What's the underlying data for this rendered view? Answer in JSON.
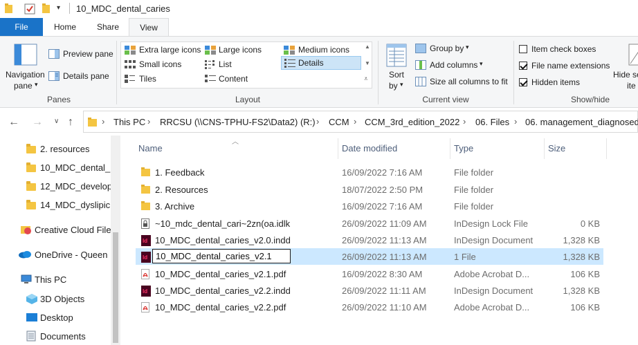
{
  "window": {
    "title": "10_MDC_dental_caries"
  },
  "tabs": [
    {
      "label": "File"
    },
    {
      "label": "Home"
    },
    {
      "label": "Share"
    },
    {
      "label": "View"
    }
  ],
  "ribbon": {
    "panes": {
      "navigation_pane_line1": "Navigation",
      "navigation_pane_line2": "pane",
      "preview_pane": "Preview pane",
      "details_pane": "Details pane",
      "label": "Panes"
    },
    "layout": {
      "extra_large_icons": "Extra large icons",
      "large_icons": "Large icons",
      "medium_icons": "Medium icons",
      "small_icons": "Small icons",
      "list": "List",
      "details": "Details",
      "tiles": "Tiles",
      "content": "Content",
      "label": "Layout"
    },
    "current_view": {
      "sort_by_line1": "Sort",
      "sort_by_line2": "by",
      "group_by": "Group by",
      "add_columns": "Add columns",
      "size_all_columns": "Size all columns to fit",
      "label": "Current view"
    },
    "show_hide": {
      "item_check_boxes": "Item check boxes",
      "file_name_extensions": "File name extensions",
      "hidden_items": "Hidden items",
      "hide_selected_line1": "Hide se",
      "hide_selected_line2": "ite",
      "label": "Show/hide",
      "item_check_boxes_checked": false,
      "file_name_extensions_checked": true,
      "hidden_items_checked": true
    }
  },
  "address": {
    "crumbs": [
      "This PC",
      "RRCSU (\\\\CNS-TPHU-FS2\\Data2) (R:)",
      "CCM",
      "CCM_3rd_edition_2022",
      "06. Files",
      "06. management_diagnosed"
    ]
  },
  "nav_pane": {
    "items": [
      {
        "label": "2. resources"
      },
      {
        "label": "10_MDC_dental_"
      },
      {
        "label": "12_MDC_develop"
      },
      {
        "label": "14_MDC_dyslipic"
      },
      {
        "label": "Creative Cloud File"
      },
      {
        "label": "OneDrive - Queen"
      },
      {
        "label": "This PC"
      },
      {
        "label": "3D Objects"
      },
      {
        "label": "Desktop"
      },
      {
        "label": "Documents"
      }
    ]
  },
  "columns": {
    "name": "Name",
    "date_modified": "Date modified",
    "type": "Type",
    "size": "Size"
  },
  "files": [
    {
      "name": "1. Feedback",
      "date": "16/09/2022 7:16 AM",
      "type": "File folder",
      "size": "",
      "icon": "folder-icon"
    },
    {
      "name": "2. Resources",
      "date": "18/07/2022 2:50 PM",
      "type": "File folder",
      "size": "",
      "icon": "folder-icon"
    },
    {
      "name": "3. Archive",
      "date": "16/09/2022 7:16 AM",
      "type": "File folder",
      "size": "",
      "icon": "folder-icon"
    },
    {
      "name": "~10_mdc_dental_cari~2zn(oa.idlk",
      "date": "26/09/2022 11:09 AM",
      "type": "InDesign Lock File",
      "size": "0 KB",
      "icon": "lock-file-icon"
    },
    {
      "name": "10_MDC_dental_caries_v2.0.indd",
      "date": "26/09/2022 11:13 AM",
      "type": "InDesign Document",
      "size": "1,328 KB",
      "icon": "indesign-icon"
    },
    {
      "name": "10_MDC_dental_caries_v2.1",
      "date": "26/09/2022 11:13 AM",
      "type": "1 File",
      "size": "1,328 KB",
      "icon": "indesign-icon"
    },
    {
      "name": "10_MDC_dental_caries_v2.1.pdf",
      "date": "16/09/2022 8:30 AM",
      "type": "Adobe Acrobat D...",
      "size": "106 KB",
      "icon": "pdf-icon"
    },
    {
      "name": "10_MDC_dental_caries_v2.2.indd",
      "date": "26/09/2022 11:11 AM",
      "type": "InDesign Document",
      "size": "1,328 KB",
      "icon": "indesign-icon"
    },
    {
      "name": "10_MDC_dental_caries_v2.2.pdf",
      "date": "26/09/2022 11:10 AM",
      "type": "Adobe Acrobat D...",
      "size": "106 KB",
      "icon": "pdf-icon"
    }
  ],
  "rename_value": "10_MDC_dental_caries_v2.1",
  "colors": {
    "accent": "#1a73c8",
    "selection": "#cce8ff",
    "folder": "#f4c542",
    "indesign": "#49021f",
    "pdf": "#d9302c"
  }
}
